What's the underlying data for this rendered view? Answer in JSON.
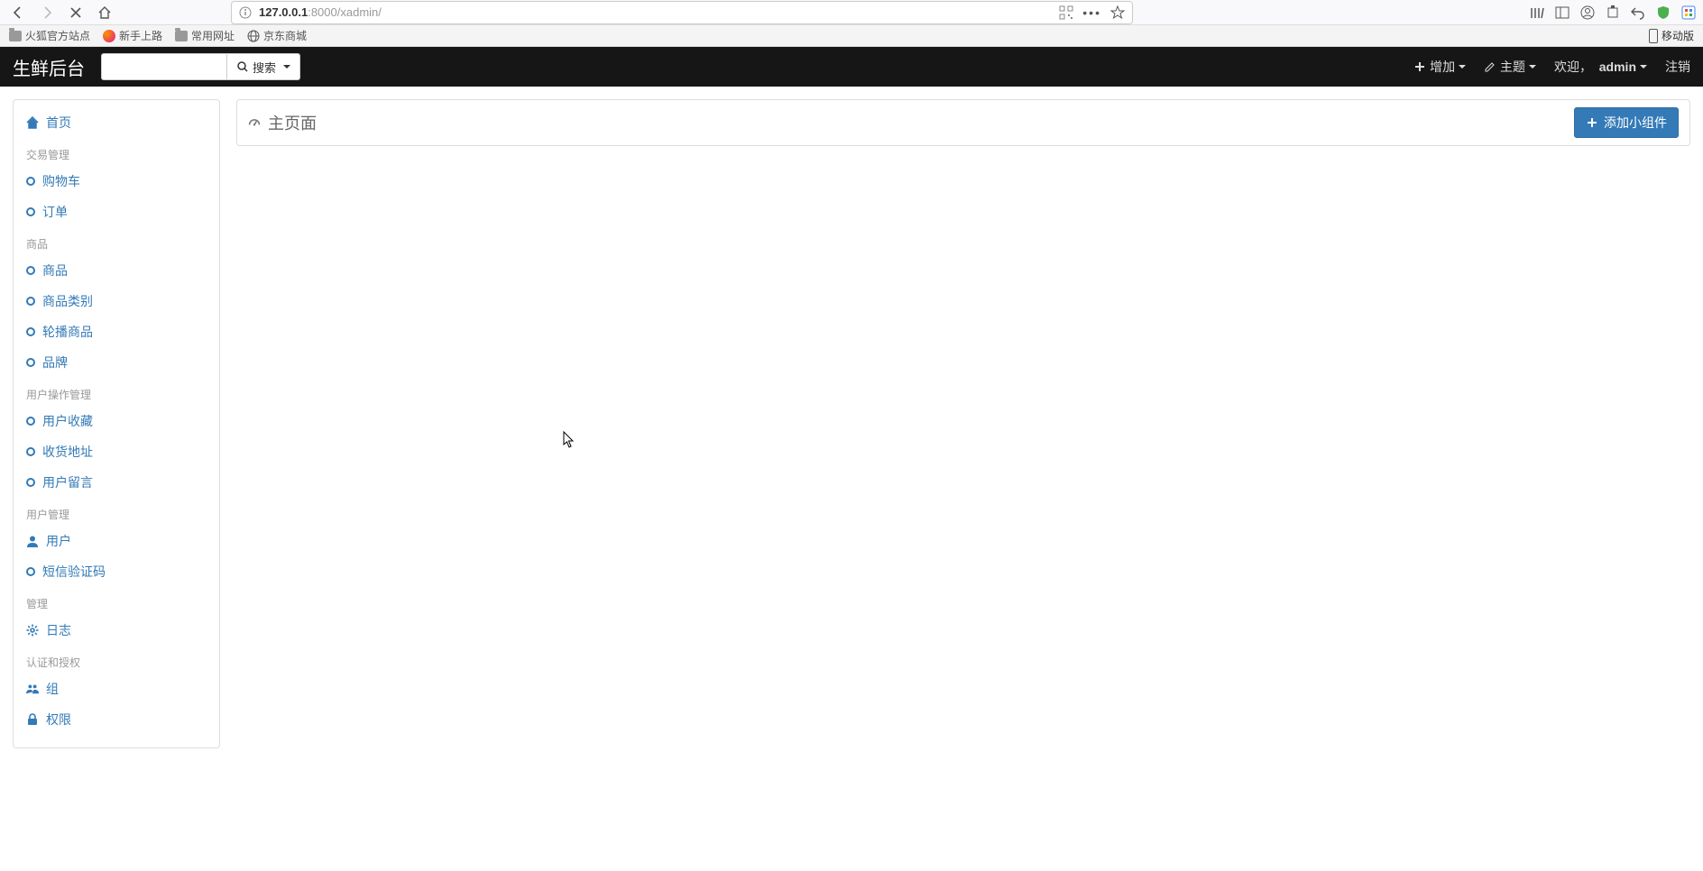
{
  "browser": {
    "url_host": "127.0.0.1",
    "url_port_path": ":8000/xadmin/",
    "bookmarks": {
      "firefox_official": "火狐官方站点",
      "new_user": "新手上路",
      "common_urls": "常用网址",
      "jd": "京东商城",
      "mobile_edition": "移动版"
    }
  },
  "navbar": {
    "brand": "生鲜后台",
    "search_button": "搜索",
    "add_label": "增加",
    "theme_label": "主题",
    "welcome_prefix": "欢迎，",
    "username": "admin",
    "logout": "注销"
  },
  "sidebar": {
    "home": "首页",
    "sections": [
      {
        "heading": "交易管理",
        "items": [
          {
            "label": "购物车",
            "icon": "bullet"
          },
          {
            "label": "订单",
            "icon": "bullet"
          }
        ]
      },
      {
        "heading": "商品",
        "items": [
          {
            "label": "商品",
            "icon": "bullet"
          },
          {
            "label": "商品类别",
            "icon": "bullet"
          },
          {
            "label": "轮播商品",
            "icon": "bullet"
          },
          {
            "label": "品牌",
            "icon": "bullet"
          }
        ]
      },
      {
        "heading": "用户操作管理",
        "items": [
          {
            "label": "用户收藏",
            "icon": "bullet"
          },
          {
            "label": "收货地址",
            "icon": "bullet"
          },
          {
            "label": "用户留言",
            "icon": "bullet"
          }
        ]
      },
      {
        "heading": "用户管理",
        "items": [
          {
            "label": "用户",
            "icon": "user"
          },
          {
            "label": "短信验证码",
            "icon": "bullet"
          }
        ]
      },
      {
        "heading": "管理",
        "items": [
          {
            "label": "日志",
            "icon": "gear"
          }
        ]
      },
      {
        "heading": "认证和授权",
        "items": [
          {
            "label": "组",
            "icon": "group"
          },
          {
            "label": "权限",
            "icon": "lock"
          }
        ]
      }
    ]
  },
  "main": {
    "page_title": "主页面",
    "add_widget": "添加小组件"
  }
}
